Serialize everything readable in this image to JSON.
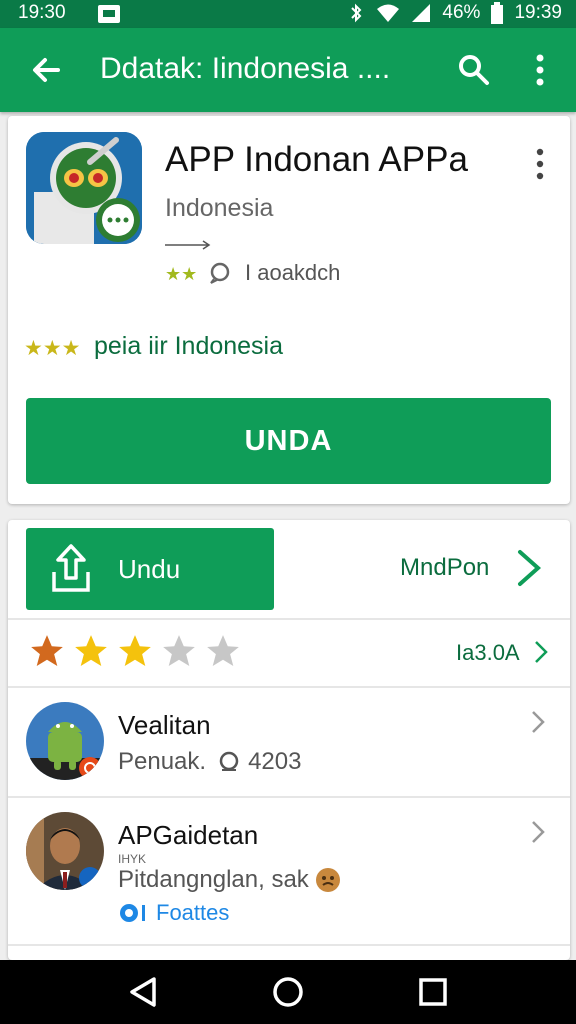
{
  "status_bar": {
    "time_left": "19:30",
    "network": "46%",
    "time_right": "19:39"
  },
  "app_bar": {
    "title": "Ddatak: Iindonesia ....",
    "back_icon": "arrow-left-icon",
    "search_icon": "search-icon",
    "more_icon": "more-vert-icon"
  },
  "app": {
    "name": "APP Indonan APPa",
    "developer": "Indonesia",
    "meta_text": "I aoakdch",
    "description": "peia iir Indonesia",
    "install_label": "UNDA"
  },
  "actions": {
    "download_label": "Undu",
    "more_label": "MndPon"
  },
  "rating": {
    "value": "Ia3.0A",
    "stars": 3,
    "max_stars": 5
  },
  "reviews": [
    {
      "name": "Vealitan",
      "sub": "Penuak.",
      "count": "4203"
    },
    {
      "name": "APGaidetan",
      "small": "IHYK",
      "sub": "Pitdangnglan, sak",
      "link": "Foattes"
    }
  ],
  "colors": {
    "primary": "#0f9d58",
    "status_bar": "#0a7a47",
    "accent_text": "#0b6c3e",
    "star_gold": "#f4c20d",
    "star_empty": "#c7c7c7"
  },
  "nav_icons": [
    "back-triangle-icon",
    "home-circle-icon",
    "recents-square-icon"
  ]
}
